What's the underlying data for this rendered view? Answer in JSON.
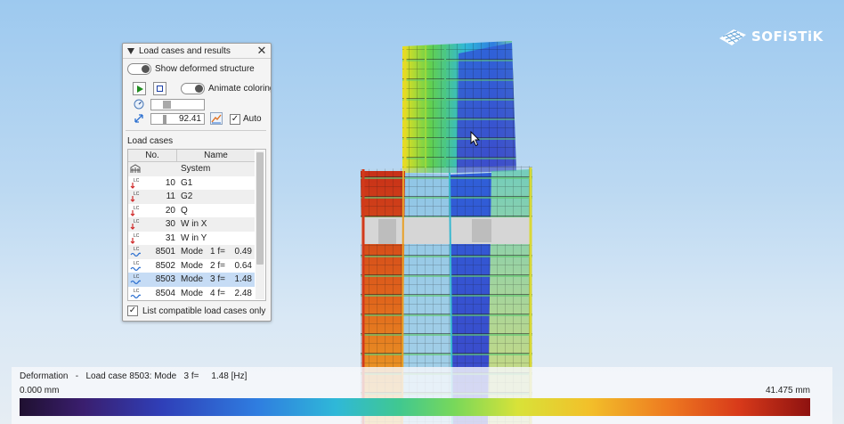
{
  "logo": {
    "text": "SOFiSTiK"
  },
  "panel": {
    "title": "Load cases and results",
    "show_deformed_label": "Show deformed structure",
    "animate_label": "Animate coloring",
    "scale_value": "92.41",
    "auto_label": "Auto",
    "auto_checked": true,
    "load_cases_heading": "Load cases",
    "columns": [
      "No.",
      "Name"
    ],
    "rows": [
      {
        "no": "",
        "name": "System",
        "f": "",
        "val": "",
        "icon": "system-icon"
      },
      {
        "no": "10",
        "name": "G1",
        "f": "",
        "val": "",
        "icon": "load-case-icon"
      },
      {
        "no": "11",
        "name": "G2",
        "f": "",
        "val": "",
        "icon": "load-case-icon"
      },
      {
        "no": "20",
        "name": "Q",
        "f": "",
        "val": "",
        "icon": "load-case-icon"
      },
      {
        "no": "30",
        "name": "W in X",
        "f": "",
        "val": "",
        "icon": "load-case-icon"
      },
      {
        "no": "31",
        "name": "W in Y",
        "f": "",
        "val": "",
        "icon": "load-case-icon"
      },
      {
        "no": "8501",
        "name": "Mode",
        "f": "1 f=",
        "val": "0.49",
        "icon": "mode-icon"
      },
      {
        "no": "8502",
        "name": "Mode",
        "f": "2 f=",
        "val": "0.64",
        "icon": "mode-icon"
      },
      {
        "no": "8503",
        "name": "Mode",
        "f": "3 f=",
        "val": "1.48",
        "icon": "mode-icon",
        "selected": true
      },
      {
        "no": "8504",
        "name": "Mode",
        "f": "4 f=",
        "val": "2.48",
        "icon": "mode-icon"
      }
    ],
    "compatible_label": "List compatible load cases only",
    "compatible_checked": true
  },
  "legend": {
    "title": "Deformation   -   Load case 8503: Mode   3 f=     1.48 [Hz]",
    "min": "0.000 mm",
    "max": "41.475 mm"
  },
  "colors": {
    "accent_selection": "#c6dcf5",
    "play_green": "#1e8b1e",
    "stop_blue": "#1a3fa8"
  }
}
